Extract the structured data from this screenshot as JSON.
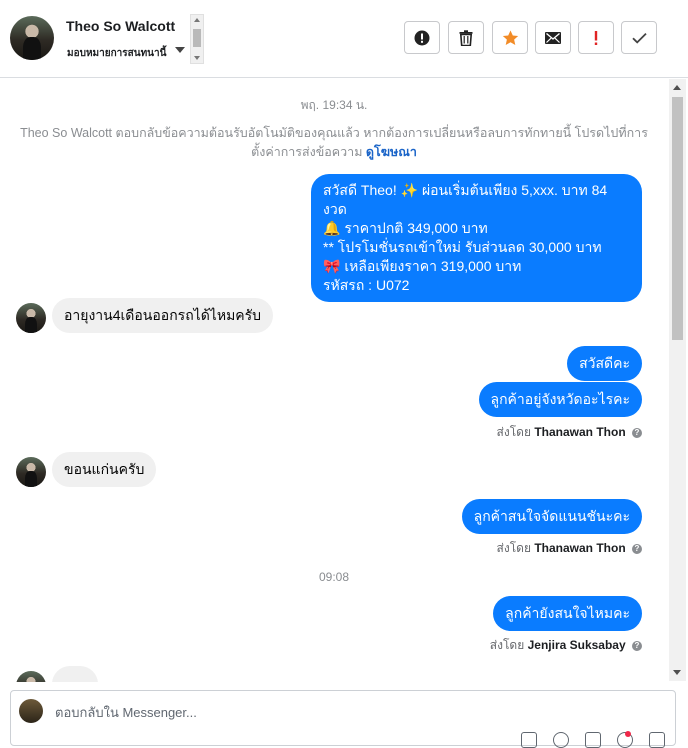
{
  "header": {
    "contact_name": "Theo So Walcott",
    "assign_label": "มอบหมายการสนทนานี้"
  },
  "toolbar": {
    "buttons": [
      {
        "name": "info-button",
        "icon": "alert-circle-icon"
      },
      {
        "name": "delete-button",
        "icon": "trash-icon"
      },
      {
        "name": "star-button",
        "icon": "star-icon",
        "color": "#f28c28"
      },
      {
        "name": "mark-unread-button",
        "icon": "envelope-icon"
      },
      {
        "name": "important-button",
        "icon": "exclamation-icon",
        "color": "#e02424"
      },
      {
        "name": "done-button",
        "icon": "check-icon"
      }
    ]
  },
  "conversation": {
    "timestamp_1": "พฤ. 19:34 น.",
    "system_note": "Theo So Walcott ตอบกลับข้อความต้อนรับอัตโนมัติของคุณแล้ว หากต้องการเปลี่ยนหรือลบการทักทายนี้ โปรดไปที่การตั้งค่าการส่งข้อความ",
    "system_note_link": "ดูโฆษณา",
    "messages": [
      {
        "direction": "out",
        "lines": [
          "สวัสดี Theo! ✨ ผ่อนเริ่มต้นเพียง 5,xxx. บาท 84 งวด",
          "🔔 ราคาปกติ 349,000 บาท",
          "** โปรโมชั่นรถเข้าใหม่ รับส่วนลด 30,000 บาท",
          "🎀 เหลือเพียงราคา 319,000 บาท",
          "รหัสรถ : U072"
        ]
      },
      {
        "direction": "in",
        "text": "อายุงาน4เดือนออกรถได้ไหมครับ"
      },
      {
        "direction": "out",
        "text": "สวัสดีคะ"
      },
      {
        "direction": "out",
        "text": "ลูกค้าอยู่จังหวัดอะไรคะ"
      },
      {
        "direction": "in",
        "text": "ขอนแก่นครับ"
      },
      {
        "direction": "out",
        "text": "ลูกค้าสนใจจัดแนนชันะคะ"
      },
      {
        "direction": "out",
        "text": "ลูกค้ายังสนใจไหมคะ"
      }
    ],
    "sent_by_prefix": "ส่งโดย",
    "sent_by_1": "Thanawan Thon",
    "sent_by_2": "Thanawan Thon",
    "sent_by_3": "Jenjira Suksabay",
    "timestamp_2": "09:08"
  },
  "reply": {
    "placeholder": "ตอบกลับใน Messenger..."
  }
}
